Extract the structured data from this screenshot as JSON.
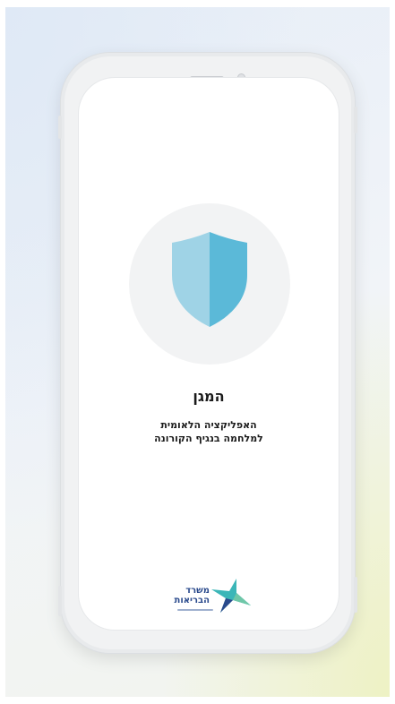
{
  "app": {
    "title": "המגן",
    "subtitle_line1": "האפליקציה הלאומית",
    "subtitle_line2": "למלחמה בנגיף הקורונה"
  },
  "logo": {
    "line1": "משרד",
    "line2": "הבריאות"
  },
  "colors": {
    "shield_light": "#9fd3e6",
    "shield_dark": "#5bb9d8",
    "text": "#1a1a1a",
    "logo_blue": "#2a4a8c",
    "logo_teal": "#3bb6b8"
  }
}
